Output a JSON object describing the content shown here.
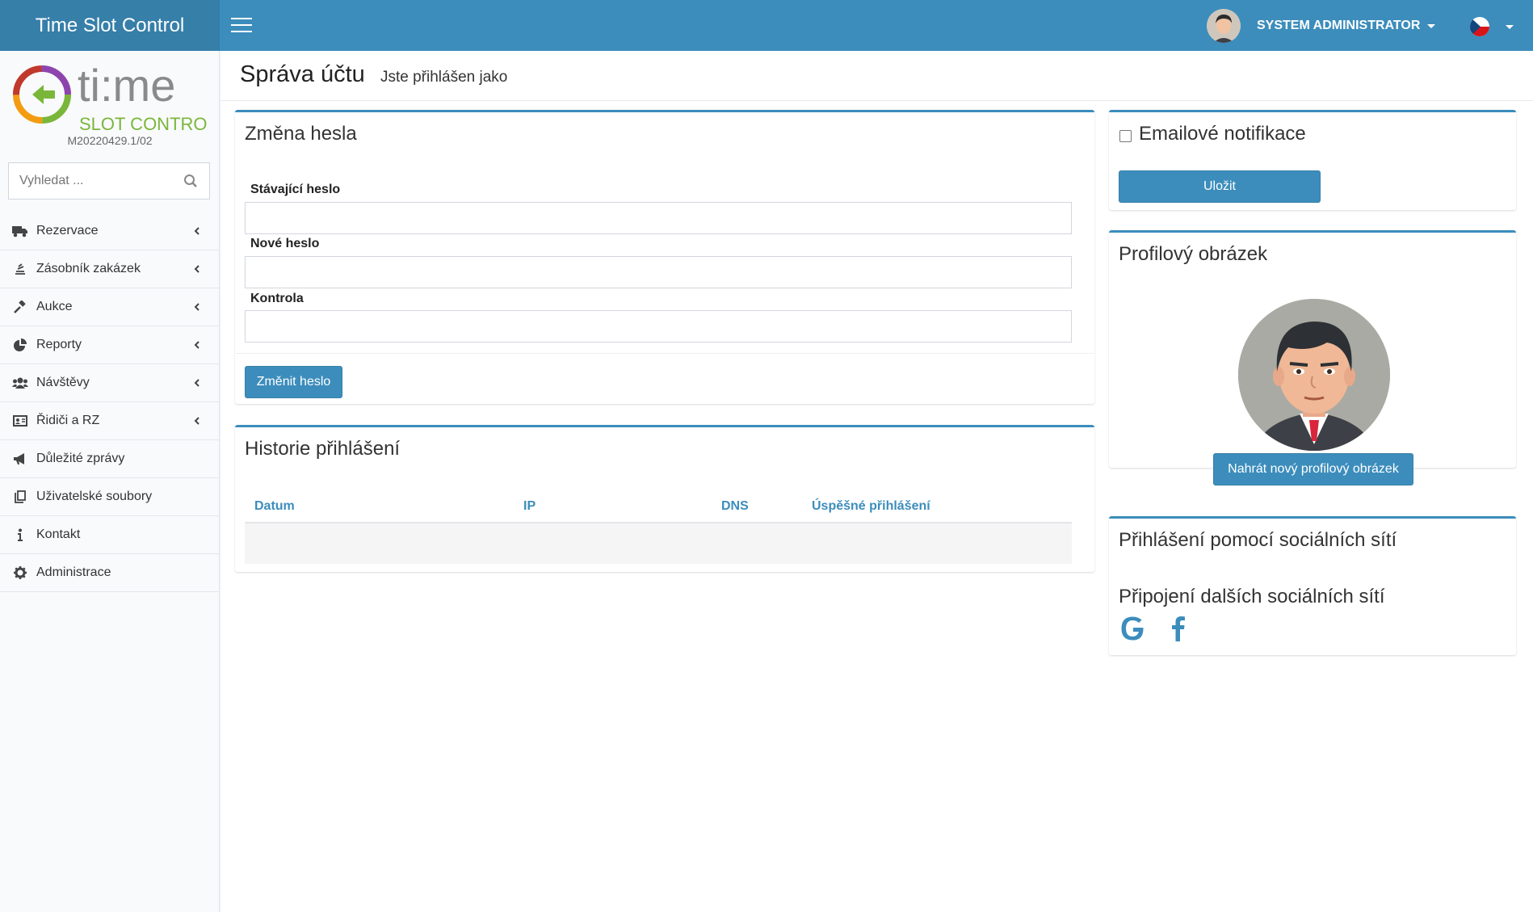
{
  "header": {
    "brand": "Time Slot Control",
    "user_name": "SYSTEM ADMINISTRATOR"
  },
  "sidebar": {
    "logo_word": "ti:me",
    "logo_sub": "SLOT CONTROL",
    "version": "M20220429.1/02",
    "search_placeholder": "Vyhledat ...",
    "items": [
      {
        "label": "Rezervace",
        "icon": "truck-icon",
        "expandable": true
      },
      {
        "label": "Zásobník zakázek",
        "icon": "stack-icon",
        "expandable": true
      },
      {
        "label": "Aukce",
        "icon": "gavel-icon",
        "expandable": true
      },
      {
        "label": "Reporty",
        "icon": "pie-chart-icon",
        "expandable": true
      },
      {
        "label": "Návštěvy",
        "icon": "users-icon",
        "expandable": true
      },
      {
        "label": "Řidiči a RZ",
        "icon": "id-card-icon",
        "expandable": true
      },
      {
        "label": "Důležité zprávy",
        "icon": "megaphone-icon",
        "expandable": false
      },
      {
        "label": "Uživatelské soubory",
        "icon": "files-icon",
        "expandable": false
      },
      {
        "label": "Kontakt",
        "icon": "info-icon",
        "expandable": false
      },
      {
        "label": "Administrace",
        "icon": "gear-icon",
        "expandable": false
      }
    ]
  },
  "page": {
    "title": "Správa účtu",
    "subtitle": "Jste přihlášen jako"
  },
  "password_box": {
    "title": "Změna hesla",
    "current_label": "Stávající heslo",
    "new_label": "Nové heslo",
    "confirm_label": "Kontrola",
    "current_value": "",
    "new_value": "",
    "confirm_value": "",
    "button": "Změnit heslo"
  },
  "history_box": {
    "title": "Historie přihlášení",
    "columns": [
      "Datum",
      "IP",
      "DNS",
      "Úspěšné přihlášení"
    ]
  },
  "email_box": {
    "label": "Emailové notifikace",
    "checked": false,
    "button": "Uložit"
  },
  "profile_box": {
    "title": "Profilový obrázek",
    "button": "Nahrát nový profilový obrázek"
  },
  "social_box": {
    "title": "Přihlášení pomocí sociálních sítí",
    "subtitle": "Připojení dalších sociálních sítí",
    "networks": [
      "google-icon",
      "facebook-icon"
    ]
  },
  "colors": {
    "primary": "#3c8dbc",
    "brand_bar": "#367fa9",
    "sidebar_bg": "#f9fafc"
  }
}
